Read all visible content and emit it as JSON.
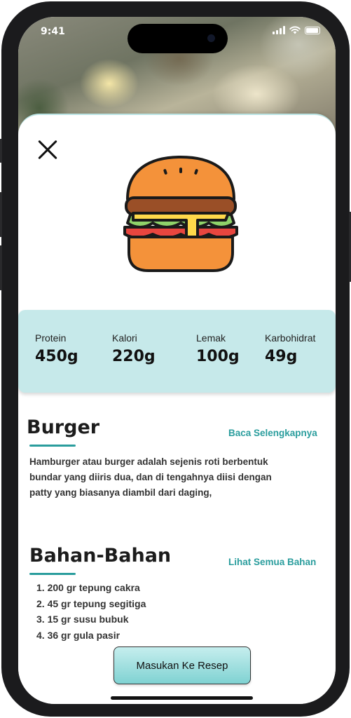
{
  "status_bar": {
    "time": "9:41"
  },
  "nutrition": [
    {
      "label": "Protein",
      "value": "450g"
    },
    {
      "label": "Kalori",
      "value": "220g"
    },
    {
      "label": "Lemak",
      "value": "100g"
    },
    {
      "label": "Karbohidrat",
      "value": "49g"
    }
  ],
  "about": {
    "title": "Burger",
    "link": "Baca Selengkapnya",
    "description": "Hamburger atau burger adalah sejenis roti berbentuk bundar yang diiris dua, dan di tengahnya diisi dengan patty yang biasanya diambil dari daging,"
  },
  "ingredients": {
    "title": "Bahan-Bahan",
    "link": "Lihat Semua Bahan",
    "items": [
      "1. 200 gr tepung cakra",
      "2. 45 gr tepung segitiga",
      "3. 15 gr susu bubuk",
      "4. 36 gr gula pasir"
    ]
  },
  "cta_label": "Masukan Ke Resep",
  "colors": {
    "accent": "#2a9d9d",
    "panel": "#c6e9ea",
    "button": "#7fd2d2"
  },
  "icons": [
    "close-icon",
    "burger-icon",
    "signal-icon",
    "wifi-icon",
    "battery-icon"
  ]
}
